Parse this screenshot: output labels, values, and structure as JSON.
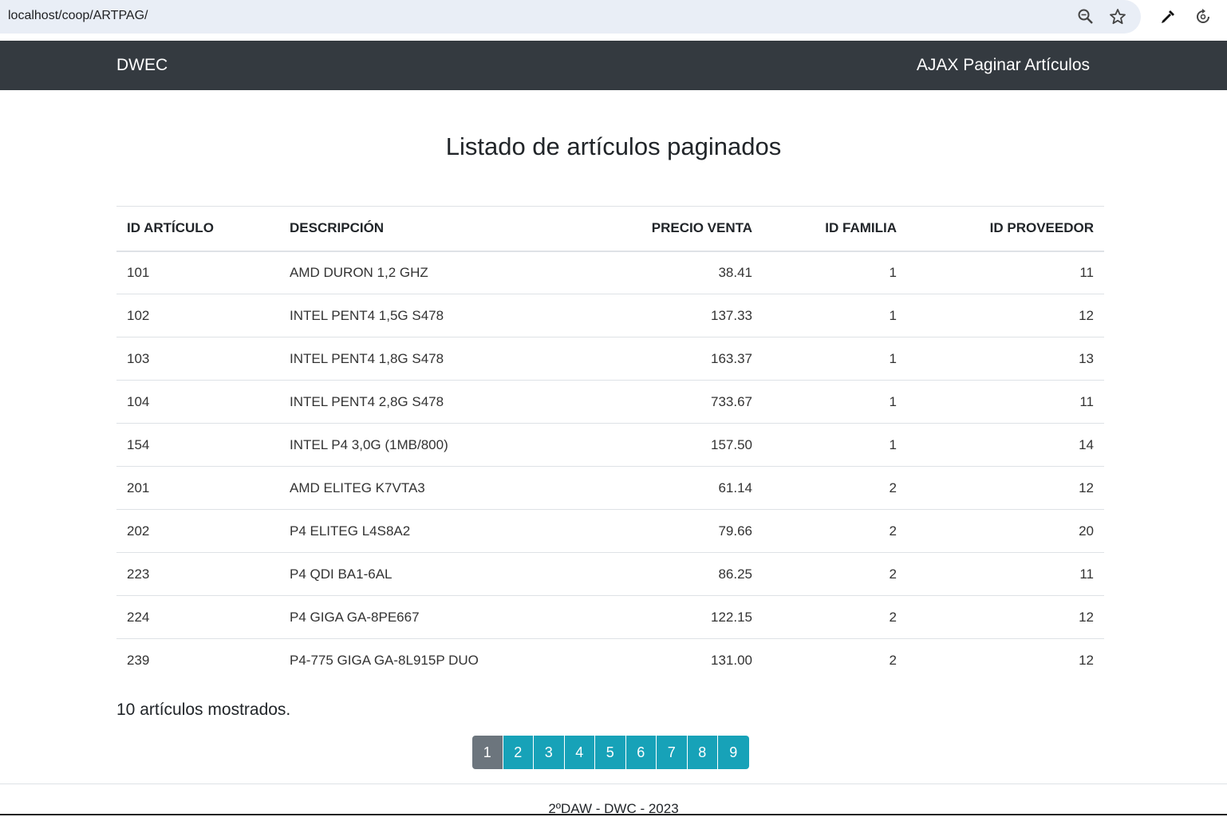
{
  "browser": {
    "url": "localhost/coop/ARTPAG/",
    "icons": [
      "zoom-icon",
      "star-icon",
      "eyedropper-icon",
      "sync-icon"
    ]
  },
  "navbar": {
    "brand": "DWEC",
    "right_link": "AJAX Paginar Artículos"
  },
  "main": {
    "title": "Listado de artículos paginados",
    "table": {
      "headers": [
        "ID ARTÍCULO",
        "DESCRIPCIÓN",
        "PRECIO VENTA",
        "ID FAMILIA",
        "ID PROVEEDOR"
      ],
      "rows": [
        [
          "101",
          "AMD DURON 1,2 GHZ",
          "38.41",
          "1",
          "11"
        ],
        [
          "102",
          "INTEL PENT4 1,5G S478",
          "137.33",
          "1",
          "12"
        ],
        [
          "103",
          "INTEL PENT4 1,8G S478",
          "163.37",
          "1",
          "13"
        ],
        [
          "104",
          "INTEL PENT4 2,8G S478",
          "733.67",
          "1",
          "11"
        ],
        [
          "154",
          "INTEL P4 3,0G (1MB/800)",
          "157.50",
          "1",
          "14"
        ],
        [
          "201",
          "AMD ELITEG K7VTA3",
          "61.14",
          "2",
          "12"
        ],
        [
          "202",
          "P4 ELITEG L4S8A2",
          "79.66",
          "2",
          "20"
        ],
        [
          "223",
          "P4 QDI BA1-6AL",
          "86.25",
          "2",
          "11"
        ],
        [
          "224",
          "P4 GIGA GA-8PE667",
          "122.15",
          "2",
          "12"
        ],
        [
          "239",
          "P4-775 GIGA GA-8L915P DUO",
          "131.00",
          "2",
          "12"
        ]
      ]
    },
    "count_text": "10 artículos mostrados.",
    "pagination": {
      "pages": [
        "1",
        "2",
        "3",
        "4",
        "5",
        "6",
        "7",
        "8",
        "9"
      ],
      "active": "1"
    }
  },
  "footer": {
    "text": "2ºDAW - DWC - 2023"
  },
  "colors": {
    "navbar": "#343a40",
    "page_button": "#17a2b8",
    "page_active": "#6c757d"
  }
}
